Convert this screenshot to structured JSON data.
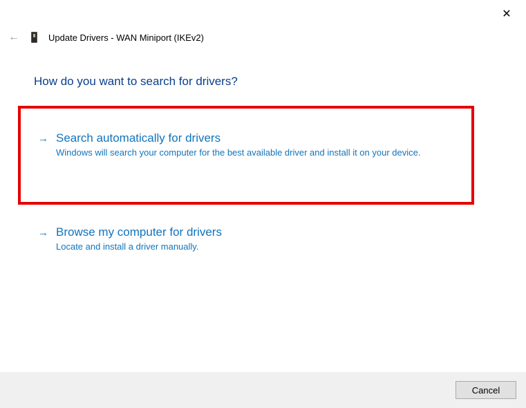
{
  "window": {
    "title": "Update Drivers - WAN Miniport (IKEv2)"
  },
  "heading": "How do you want to search for drivers?",
  "options": [
    {
      "arrow": "→",
      "title": "Search automatically for drivers",
      "description": "Windows will search your computer for the best available driver and install it on your device."
    },
    {
      "arrow": "→",
      "title": "Browse my computer for drivers",
      "description": "Locate and install a driver manually."
    }
  ],
  "footer": {
    "cancel_label": "Cancel"
  },
  "icons": {
    "back_arrow": "←",
    "close": "✕"
  }
}
